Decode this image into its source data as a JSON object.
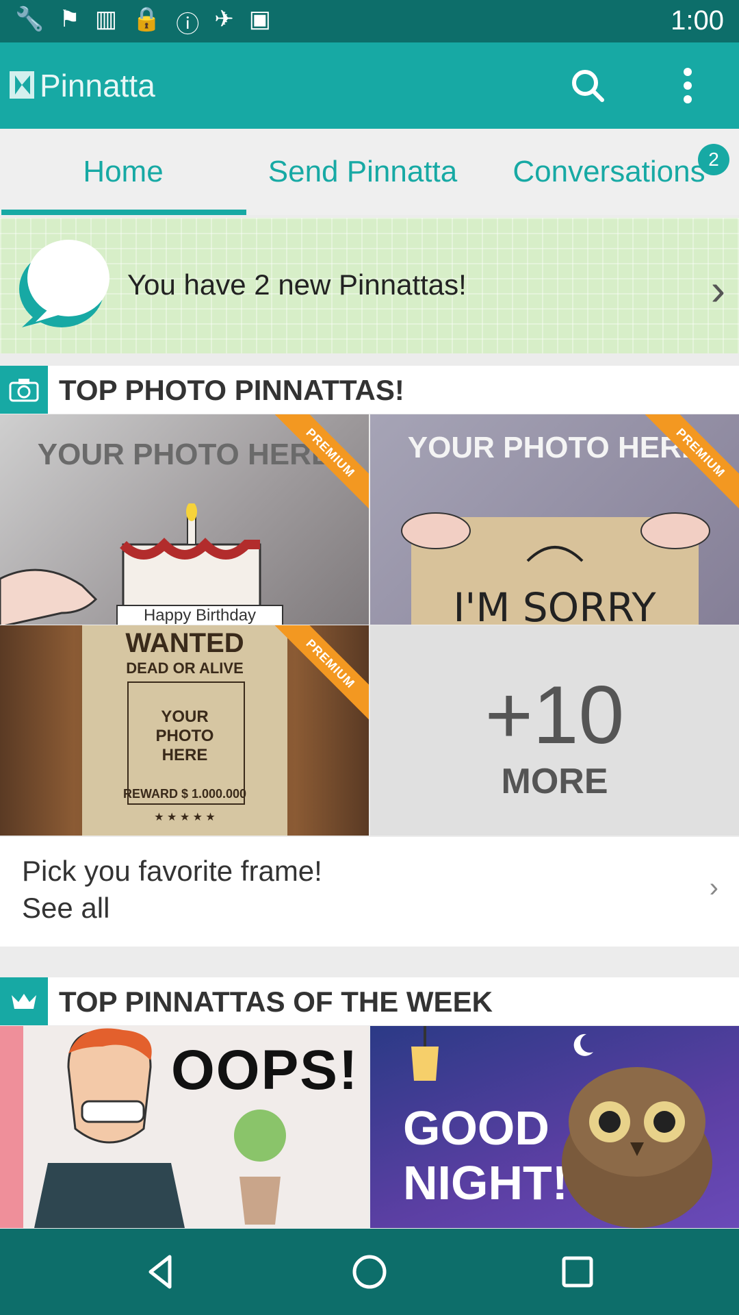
{
  "status_bar": {
    "time": "1:00"
  },
  "app_bar": {
    "title": "Pinnatta"
  },
  "tabs": [
    {
      "label": "Home"
    },
    {
      "label": "Send Pinnatta"
    },
    {
      "label": "Conversations",
      "badge": "2"
    }
  ],
  "banner": {
    "text": "You have 2 new Pinnattas!"
  },
  "section_photo": {
    "title": "TOP PHOTO PINNATTAS!",
    "tiles": [
      {
        "ribbon": "PREMIUM",
        "photo_text": "YOUR PHOTO HERE",
        "caption": "Happy Birthday"
      },
      {
        "ribbon": "PREMIUM",
        "photo_text": "YOUR PHOTO HERE",
        "caption": "I'M SORRY"
      },
      {
        "ribbon": "PREMIUM",
        "header": "WANTED",
        "sub": "DEAD OR ALIVE",
        "photo_text": "YOUR PHOTO HERE",
        "reward": "REWARD $ 1.000.000",
        "stars": "★ ★ ★ ★ ★"
      }
    ],
    "more_count": "+10",
    "more_label": "MORE"
  },
  "pick": {
    "line1": "Pick you favorite frame!",
    "line2": "See all"
  },
  "section_week": {
    "title": "TOP PINNATTAS OF THE WEEK",
    "tiles": [
      {
        "text": "OOPS!"
      },
      {
        "text_line1": "GOOD",
        "text_line2": "NIGHT!"
      }
    ]
  },
  "colors": {
    "teal": "#17a9a4",
    "dark_teal": "#0d6e6a",
    "ribbon": "#f39821"
  }
}
